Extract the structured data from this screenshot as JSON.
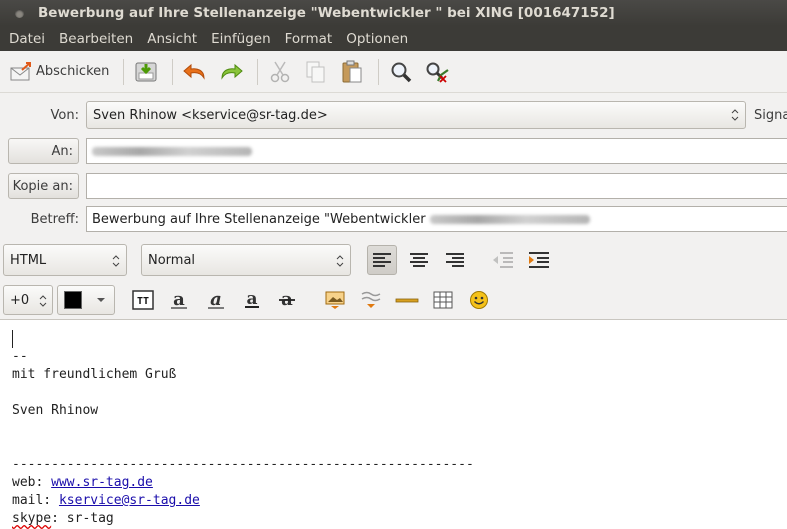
{
  "window": {
    "title": "Bewerbung auf Ihre Stellenanzeige \"Webentwickler  \" bei XING [001647152]"
  },
  "menu": [
    "Datei",
    "Bearbeiten",
    "Ansicht",
    "Einfügen",
    "Format",
    "Optionen"
  ],
  "toolbar": {
    "send_label": "Abschicken"
  },
  "header": {
    "from_label": "Von:",
    "from_value": "Sven Rhinow <kservice@sr-tag.de>",
    "signature_label": "Signa",
    "to_label": "An:",
    "cc_label": "Kopie an:",
    "cc_value": "",
    "subject_label": "Betreff:",
    "subject_value": "Bewerbung auf Ihre Stellenanzeige \"Webentwickler"
  },
  "format": {
    "paragraph_mode": "HTML",
    "paragraph_style": "Normal",
    "font_size": "+0",
    "text_color": "#000000"
  },
  "body": {
    "lines": [
      "",
      "--",
      "mit freundlichem Gruß",
      "",
      "Sven Rhinow",
      "",
      "",
      "-----------------------------------------------------------"
    ],
    "web_label": "web: ",
    "web_link": "www.sr-tag.de",
    "mail_label": "mail: ",
    "mail_link": "kservice@sr-tag.de",
    "skype_label": "skype",
    "skype_value": ": sr-tag"
  }
}
